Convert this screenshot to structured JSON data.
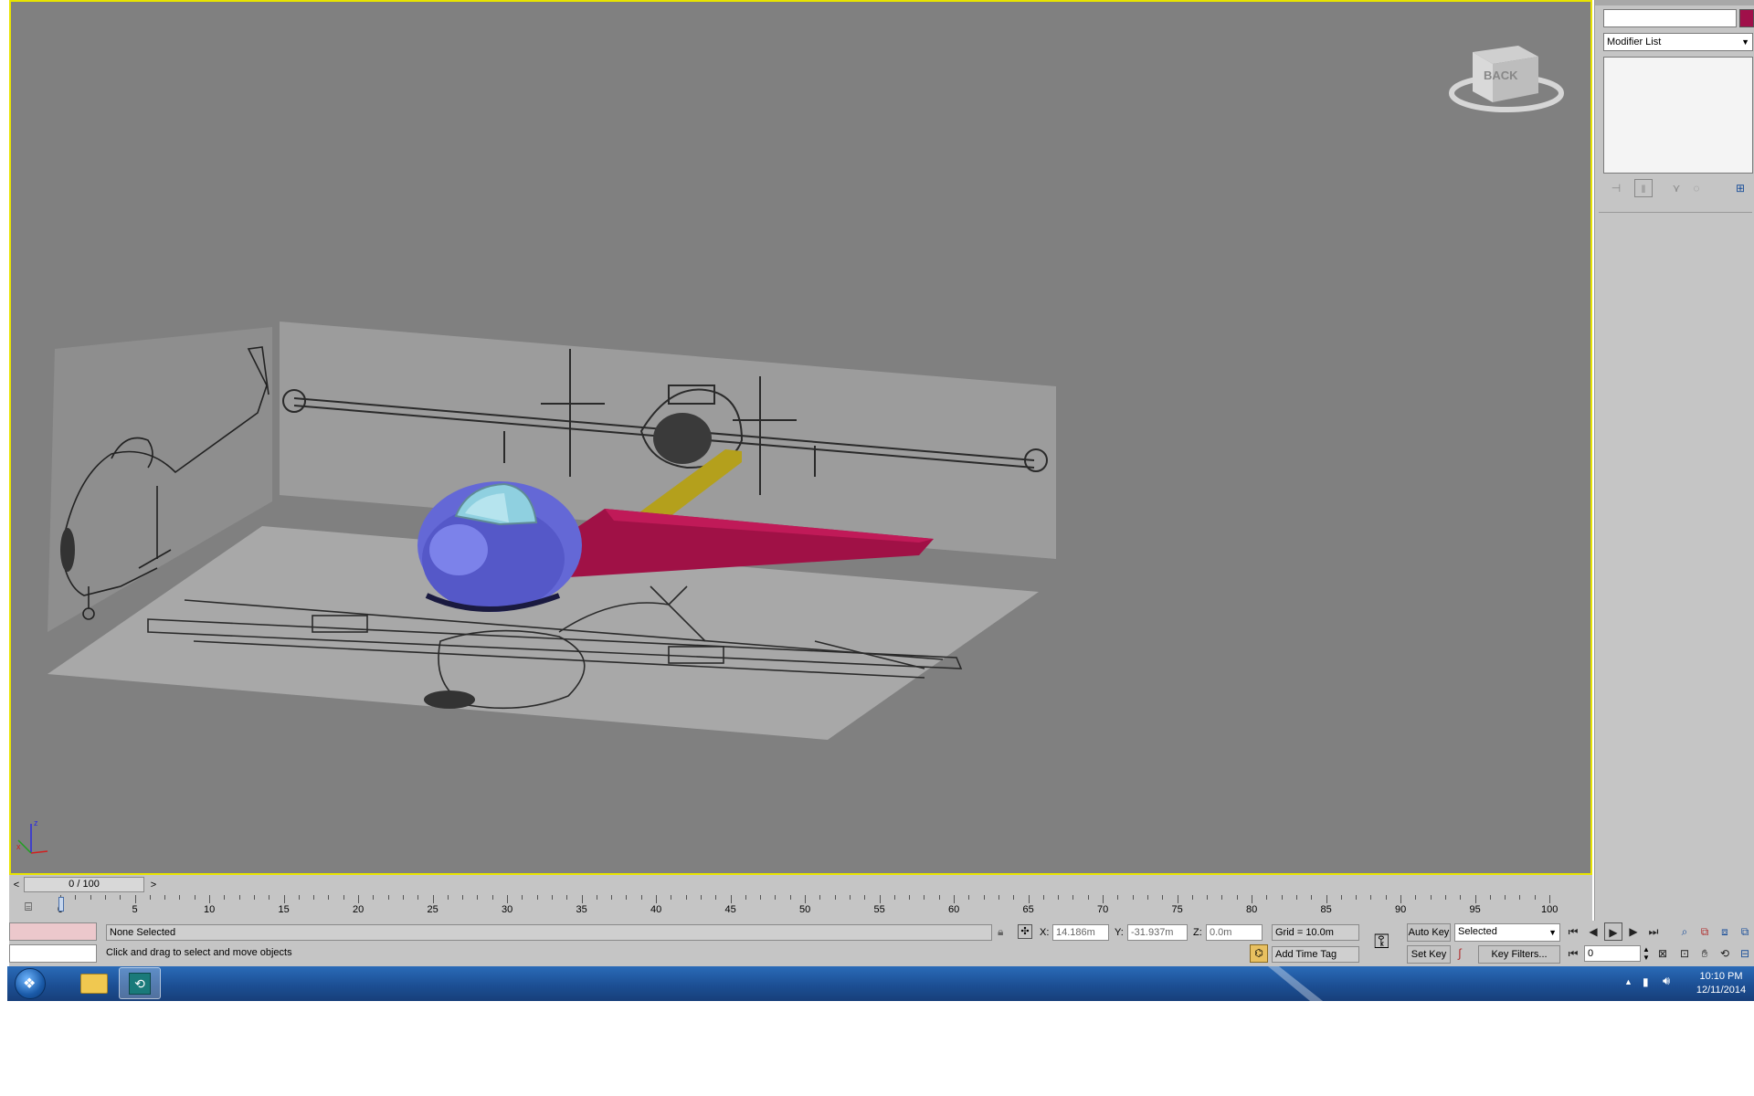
{
  "command_panel": {
    "modifier_list_label": "Modifier List",
    "name_field_value": "",
    "accent_color": "#a0104a"
  },
  "viewport": {
    "viewcube_label": "BACK",
    "axis_z": "z",
    "axis_x": "x",
    "colors": {
      "border": "#e8e400",
      "background": "#808080",
      "fuselage": "#6a6fd8",
      "wing": "#a3124a",
      "spar": "#b8a81e",
      "canopy": "#8fd0e0"
    }
  },
  "timeline": {
    "frame_label": "0 / 100",
    "prev_arrow": "<",
    "next_arrow": ">",
    "ticks": [
      "0",
      "5",
      "10",
      "15",
      "20",
      "25",
      "30",
      "35",
      "40",
      "45",
      "50",
      "55",
      "60",
      "65",
      "70",
      "75",
      "80",
      "85",
      "90",
      "95",
      "100"
    ]
  },
  "status_bar": {
    "selection_status": "None Selected",
    "prompt": "Click and drag to select and move objects",
    "x_label": "X:",
    "x_value": "14.186m",
    "y_label": "Y:",
    "y_value": "-31.937m",
    "z_label": "Z:",
    "z_value": "0.0m",
    "grid": "Grid = 10.0m",
    "add_time_tag": "Add Time Tag",
    "auto_key": "Auto Key",
    "set_key": "Set Key",
    "selected_dropdown": "Selected",
    "key_filters": "Key Filters...",
    "frame_field": "0"
  },
  "taskbar": {
    "time": "10:10 PM",
    "date": "12/11/2014"
  }
}
